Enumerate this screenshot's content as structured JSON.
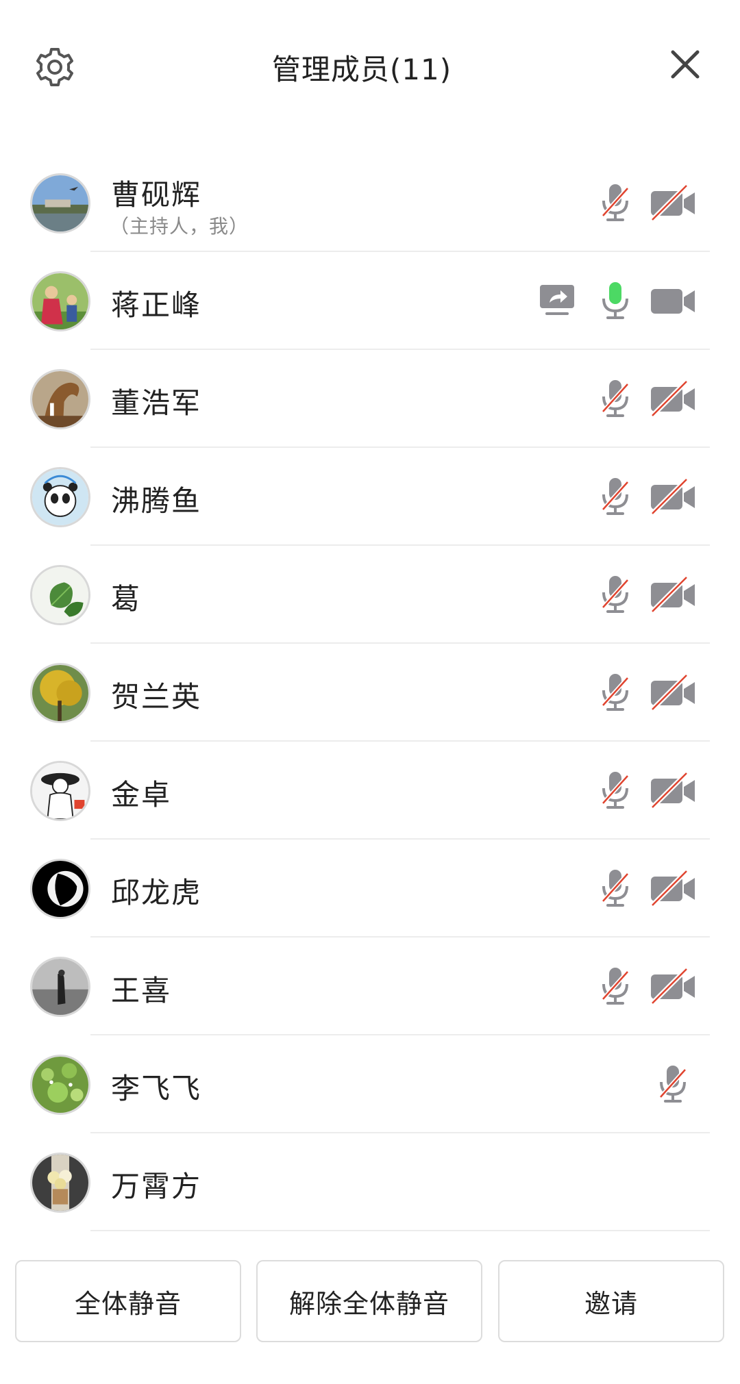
{
  "header": {
    "title": "管理成员(11)",
    "settings_icon": "gear-icon",
    "close_icon": "close-icon"
  },
  "members": [
    {
      "name": "曹砚辉",
      "subtitle": "（主持人，我）",
      "mic": "muted",
      "camera": "off",
      "sharing": false
    },
    {
      "name": "蒋正峰",
      "subtitle": "",
      "mic": "active",
      "camera": "on",
      "sharing": true
    },
    {
      "name": "董浩军",
      "subtitle": "",
      "mic": "muted",
      "camera": "off",
      "sharing": false
    },
    {
      "name": "沸腾鱼",
      "subtitle": "",
      "mic": "muted",
      "camera": "off",
      "sharing": false
    },
    {
      "name": "葛",
      "subtitle": "",
      "mic": "muted",
      "camera": "off",
      "sharing": false
    },
    {
      "name": "贺兰英",
      "subtitle": "",
      "mic": "muted",
      "camera": "off",
      "sharing": false
    },
    {
      "name": "金卓",
      "subtitle": "",
      "mic": "muted",
      "camera": "off",
      "sharing": false
    },
    {
      "name": "邱龙虎",
      "subtitle": "",
      "mic": "muted",
      "camera": "off",
      "sharing": false
    },
    {
      "name": "王喜",
      "subtitle": "",
      "mic": "muted",
      "camera": "off",
      "sharing": false
    },
    {
      "name": "李飞飞",
      "subtitle": "",
      "mic": "muted",
      "camera": "none",
      "sharing": false
    },
    {
      "name": "万霄方",
      "subtitle": "",
      "mic": "none",
      "camera": "none",
      "sharing": false
    }
  ],
  "footer": {
    "mute_all": "全体静音",
    "unmute_all": "解除全体静音",
    "invite": "邀请"
  },
  "colors": {
    "icon_gray": "#8e8e93",
    "muted_red": "#e0442f",
    "active_green": "#4cd964",
    "divider": "#ececec"
  }
}
